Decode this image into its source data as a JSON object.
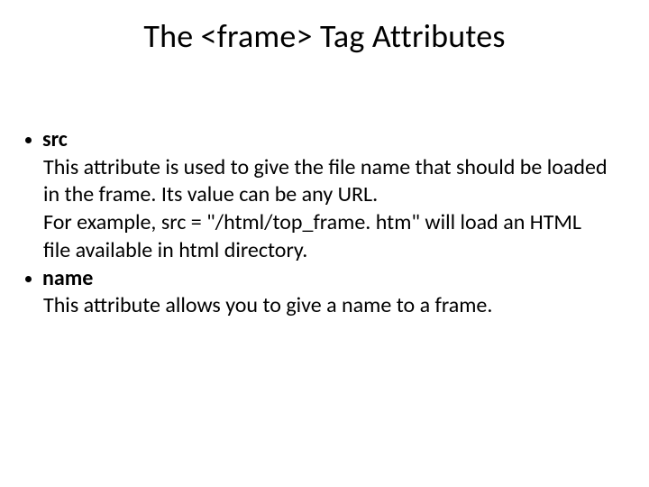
{
  "title": "The <frame> Tag Attributes",
  "items": [
    {
      "label": "src",
      "paras": [
        "This attribute is used to give the file name that should be loaded in the frame. Its value can be any URL.",
        " For example, src = \"/html/top_frame. htm\" will load an HTML file available in html directory."
      ]
    },
    {
      "label": "name",
      "paras": [
        "This attribute allows you to give a name to a frame."
      ]
    }
  ]
}
